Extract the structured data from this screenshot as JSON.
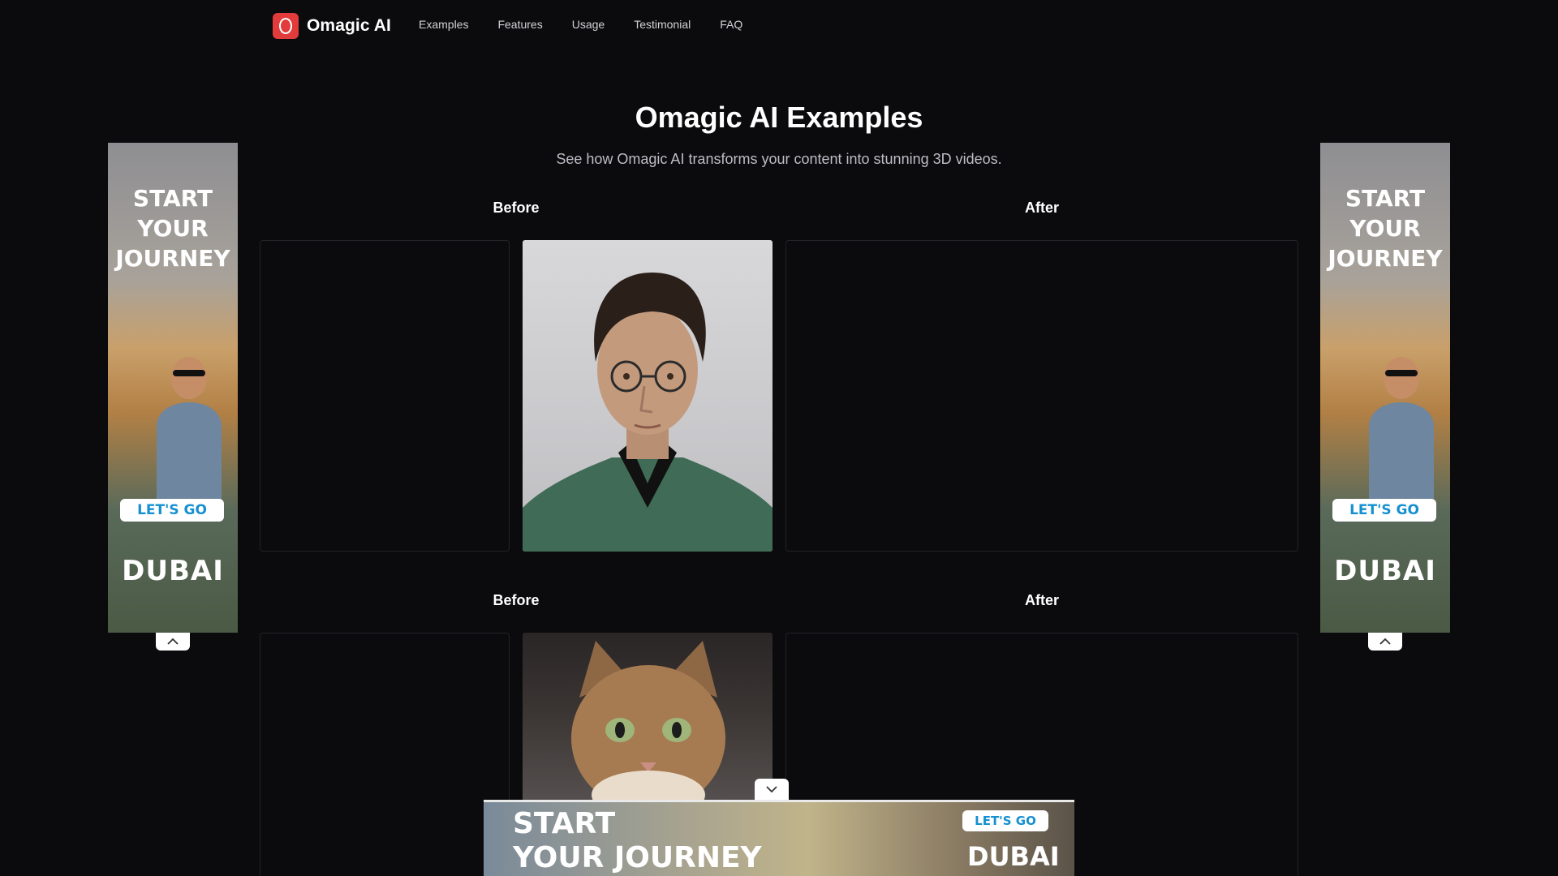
{
  "header": {
    "brand_name": "Omagic AI",
    "nav": [
      "Examples",
      "Features",
      "Usage",
      "Testimonial",
      "FAQ"
    ]
  },
  "examples": {
    "title": "Omagic AI Examples",
    "subtitle": "See how Omagic AI transforms your content into stunning 3D videos.",
    "rows": [
      {
        "before_label": "Before",
        "after_label": "After",
        "image": "man-portrait"
      },
      {
        "before_label": "Before",
        "after_label": "After",
        "image": "cat-portrait"
      }
    ]
  },
  "ads": {
    "side_headline_lines": [
      "START",
      "YOUR",
      "JOURNEY"
    ],
    "button": "LET'S GO",
    "logo": "DUBAI",
    "bottom_headline_lines": [
      "START",
      "YOUR JOURNEY"
    ]
  },
  "colors": {
    "background": "#0b0b0d",
    "brand": "#e23b3b",
    "ad_button_text": "#1590d0"
  }
}
